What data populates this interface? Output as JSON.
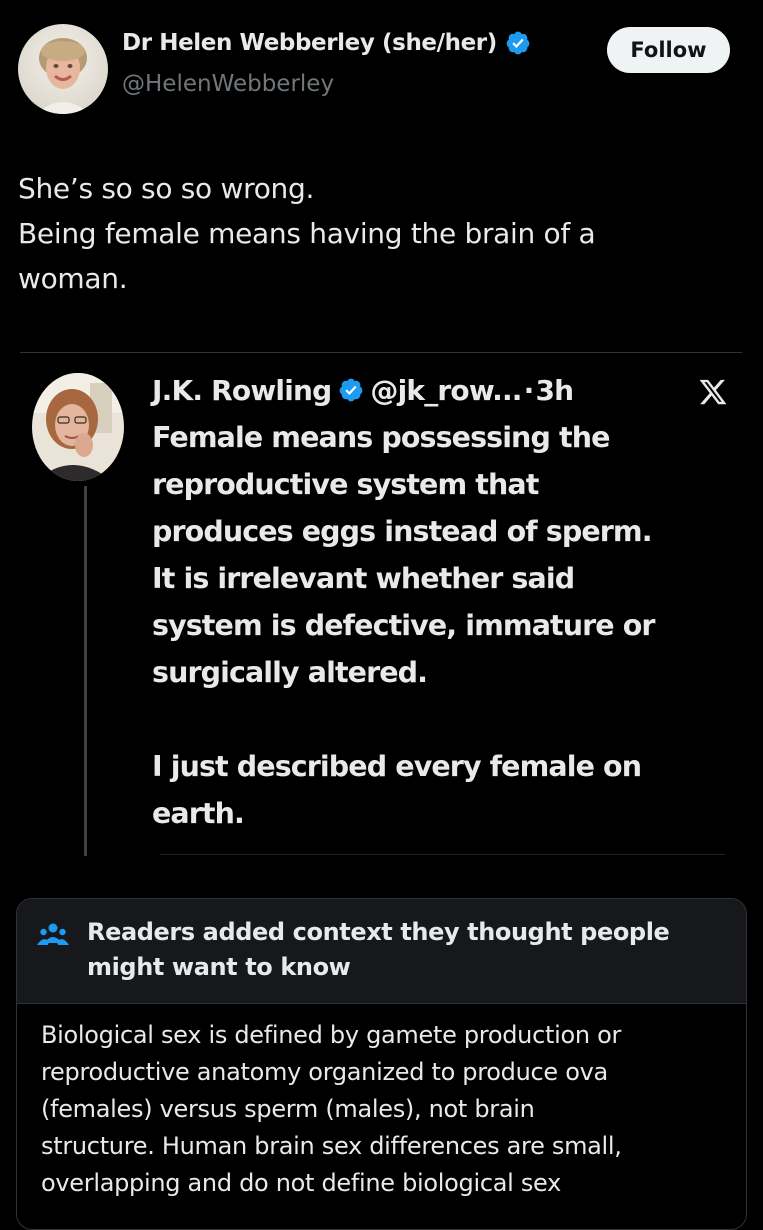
{
  "colors": {
    "background": "#000000",
    "text": "#e7e9ea",
    "secondary": "#71767b",
    "verified_blue": "#1d9bf0",
    "follow_button_bg": "#eff3f4",
    "note_header_bg": "#16181c",
    "note_icon": "#1d9bf0"
  },
  "post": {
    "author": {
      "name": "Dr Helen Webberley (she/her)",
      "handle": "@HelenWebberley",
      "verified": true,
      "avatar_icon": "profile-photo"
    },
    "follow_label": "Follow",
    "text_lines": [
      "She’s so so so wrong.",
      "Being female means having the brain of a",
      "woman."
    ]
  },
  "quote": {
    "author": {
      "name": "J.K. Rowling",
      "handle": "@jk_row...",
      "separator": "·",
      "time": "3h",
      "verified": true,
      "avatar_icon": "profile-photo"
    },
    "source_icon": "x-logo-icon",
    "text_lines": [
      "Female means possessing the",
      "reproductive system that",
      "produces eggs instead of sperm.",
      "It is irrelevant whether said",
      "system is defective, immature or",
      "surgically altered.",
      "",
      "I just described every female on",
      "earth."
    ]
  },
  "community_note": {
    "icon": "people-icon",
    "title_lines": [
      "Readers added context they thought people",
      "might want to know"
    ],
    "body_lines": [
      "Biological sex is defined by gamete production or",
      "reproductive anatomy organized to produce ova",
      "(females) versus sperm (males), not brain",
      "structure. Human brain sex differences are small,",
      "overlapping and do not define biological sex"
    ]
  }
}
